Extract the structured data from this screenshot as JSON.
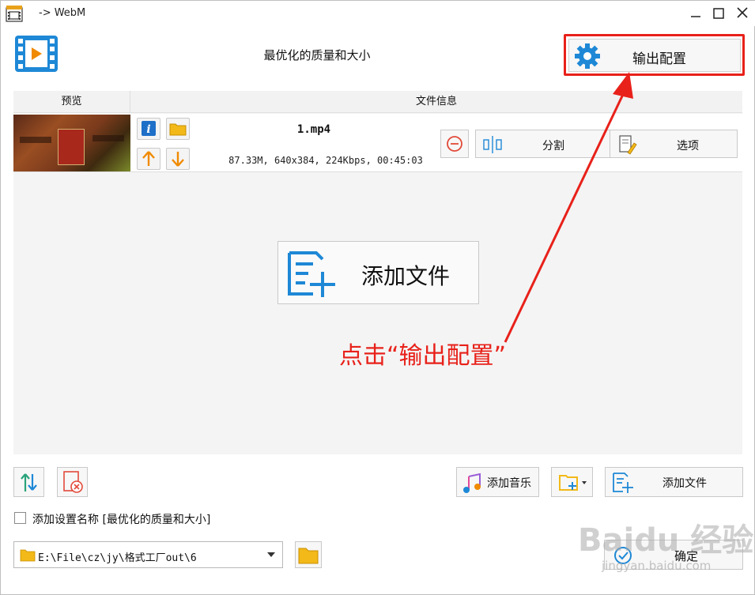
{
  "window": {
    "title": "-> WebM"
  },
  "header": {
    "profile_title": "最优化的质量和大小",
    "output_config_label": "输出配置"
  },
  "list": {
    "columns": {
      "preview": "预览",
      "file_info": "文件信息"
    },
    "rows": [
      {
        "filename": "1.mp4",
        "meta": "87.33M, 640x384, 224Kbps, 00:45:03",
        "split_label": "分割",
        "options_label": "选项"
      }
    ]
  },
  "center": {
    "add_file_label": "添加文件"
  },
  "annotation": {
    "text": "点击“输出配置”",
    "color": "#e8211a"
  },
  "toolbar": {
    "add_music_label": "添加音乐",
    "add_file_label": "添加文件"
  },
  "settings": {
    "add_setting_name_label": "添加设置名称 [最优化的质量和大小]",
    "checked": false
  },
  "output": {
    "path": "E:\\File\\cz\\jy\\格式工厂out\\6",
    "ok_label": "确定"
  },
  "watermark": {
    "brand": "Baidu 经验",
    "url": "jingyan.baidu.com"
  },
  "colors": {
    "accent": "#1e88d6",
    "highlight": "#e8211a",
    "arrow_orange": "#f08a00"
  }
}
